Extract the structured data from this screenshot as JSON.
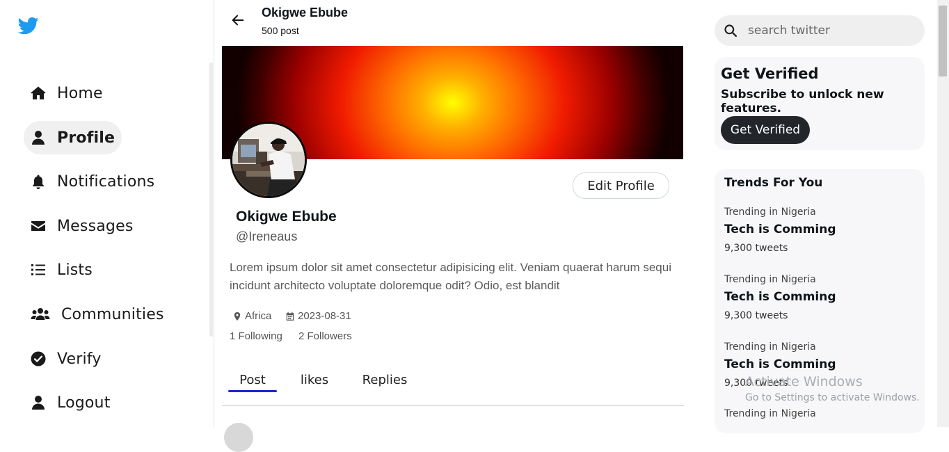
{
  "sidebar": {
    "logo": "twitter-bird-icon",
    "items": [
      {
        "label": "Home",
        "icon": "home-icon",
        "active": false
      },
      {
        "label": "Profile",
        "icon": "user-icon",
        "active": true
      },
      {
        "label": "Notifications",
        "icon": "bell-icon",
        "active": false
      },
      {
        "label": "Messages",
        "icon": "envelope-icon",
        "active": false
      },
      {
        "label": "Lists",
        "icon": "list-icon",
        "active": false
      },
      {
        "label": "Communities",
        "icon": "users-icon",
        "active": false
      },
      {
        "label": "Verify",
        "icon": "check-circle-icon",
        "active": false
      },
      {
        "label": "Logout",
        "icon": "user-icon",
        "active": false
      }
    ]
  },
  "header": {
    "name": "Okigwe Ebube",
    "post_count": "500 post"
  },
  "profile": {
    "name": "Okigwe Ebube",
    "handle": "@Ireneaus",
    "edit_label": "Edit Profile",
    "bio": "Lorem ipsum dolor sit amet consectetur adipisicing elit. Veniam quaerat harum sequi incidunt architecto voluptate doloremque odit? Odio, est blandit",
    "location": "Africa",
    "joined": "2023-08-31",
    "following": "1 Following",
    "followers": "2 Followers"
  },
  "tabs": [
    {
      "label": "Post",
      "active": true
    },
    {
      "label": "likes",
      "active": false
    },
    {
      "label": "Replies",
      "active": false
    }
  ],
  "search": {
    "placeholder": "search twitter"
  },
  "verify_card": {
    "title": "Get Verified",
    "subtitle": "Subscribe to unlock new features.",
    "button": "Get Verified"
  },
  "trends": {
    "title": "Trends For You",
    "items": [
      {
        "location": "Trending in Nigeria",
        "topic": "Tech is Comming",
        "count": "9,300 tweets"
      },
      {
        "location": "Trending in Nigeria",
        "topic": "Tech is Comming",
        "count": "9,300 tweets"
      },
      {
        "location": "Trending in Nigeria",
        "topic": "Tech is Comming",
        "count": "9,300 tweets"
      },
      {
        "location": "Trending in Nigeria",
        "topic": "",
        "count": ""
      }
    ]
  },
  "watermark": {
    "line1": "Activate Windows",
    "line2": "Go to Settings to activate Windows."
  },
  "colors": {
    "brand_blue": "#1d9bf0",
    "tab_underline": "#1526d6",
    "dark_button": "#22262b"
  }
}
